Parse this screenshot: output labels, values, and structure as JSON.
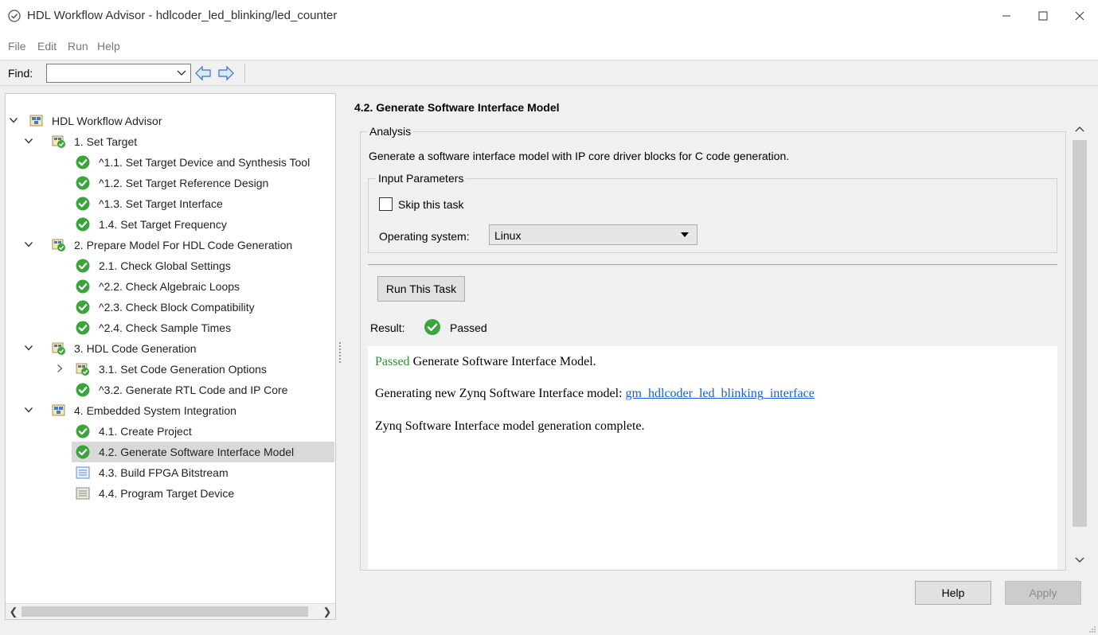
{
  "window": {
    "title": "HDL Workflow Advisor - hdlcoder_led_blinking/led_counter",
    "app_icon": "check-circle-icon",
    "controls": [
      "minimize-icon",
      "maximize-icon",
      "close-icon"
    ]
  },
  "menu": [
    "File",
    "Edit",
    "Run",
    "Help"
  ],
  "toolbar": {
    "find_label": "Find:",
    "find_value": "",
    "back_icon": "arrow-left-icon",
    "forward_icon": "arrow-right-icon"
  },
  "tree": [
    {
      "label": "HDL Workflow Advisor",
      "level": 0,
      "expanded": true,
      "icon": "folder-root-icon"
    },
    {
      "label": "1. Set Target",
      "level": 1,
      "expanded": true,
      "icon": "folder-check-icon"
    },
    {
      "label": "^1.1. Set Target Device and Synthesis Tool",
      "level": 2,
      "icon": "check-icon"
    },
    {
      "label": "^1.2. Set Target Reference Design",
      "level": 2,
      "icon": "check-icon"
    },
    {
      "label": "^1.3. Set Target Interface",
      "level": 2,
      "icon": "check-icon"
    },
    {
      "label": "1.4. Set Target Frequency",
      "level": 2,
      "icon": "check-icon"
    },
    {
      "label": "2. Prepare Model For HDL Code Generation",
      "level": 1,
      "expanded": true,
      "icon": "folder-check-icon"
    },
    {
      "label": "2.1. Check Global Settings",
      "level": 2,
      "icon": "check-icon"
    },
    {
      "label": "^2.2. Check Algebraic Loops",
      "level": 2,
      "icon": "check-icon"
    },
    {
      "label": "^2.3. Check Block Compatibility",
      "level": 2,
      "icon": "check-icon"
    },
    {
      "label": "^2.4. Check Sample Times",
      "level": 2,
      "icon": "check-icon"
    },
    {
      "label": "3. HDL Code Generation",
      "level": 1,
      "expanded": true,
      "icon": "folder-check-icon"
    },
    {
      "label": "3.1. Set Code Generation Options",
      "level": 2,
      "expanded": false,
      "icon": "folder-check-icon"
    },
    {
      "label": "^3.2. Generate RTL Code and IP Core",
      "level": 2,
      "icon": "check-icon"
    },
    {
      "label": "4. Embedded System Integration",
      "level": 1,
      "expanded": true,
      "icon": "folder-root-icon"
    },
    {
      "label": "4.1. Create Project",
      "level": 2,
      "icon": "check-icon"
    },
    {
      "label": "4.2. Generate Software Interface Model",
      "level": 2,
      "icon": "check-icon",
      "selected": true
    },
    {
      "label": "4.3. Build FPGA Bitstream",
      "level": 2,
      "icon": "task-list-icon"
    },
    {
      "label": "4.4. Program Target Device",
      "level": 2,
      "icon": "task-list-gray-icon"
    }
  ],
  "task": {
    "title": "4.2. Generate Software Interface Model",
    "analysis_legend": "Analysis",
    "description": "Generate a software interface model with IP core driver blocks for C code generation.",
    "input_params_legend": "Input Parameters",
    "skip_label": "Skip this task",
    "skip_checked": false,
    "os_label": "Operating system:",
    "os_value": "Linux",
    "run_button": "Run This Task",
    "result_label": "Result:",
    "result_value": "Passed",
    "report": {
      "line1_status": "Passed",
      "line1_text": " Generate Software Interface Model.",
      "line2_text": "Generating new Zynq Software Interface model: ",
      "line2_link": "gm_hdlcoder_led_blinking_interface",
      "line3_text": "Zynq Software Interface model generation complete."
    }
  },
  "buttons": {
    "help": "Help",
    "apply": "Apply"
  },
  "colors": {
    "pass_green": "#2f8f2f",
    "link_blue": "#1a5ed6",
    "check_green": "#3aa53a",
    "selected_bg": "#d9d9d9"
  }
}
